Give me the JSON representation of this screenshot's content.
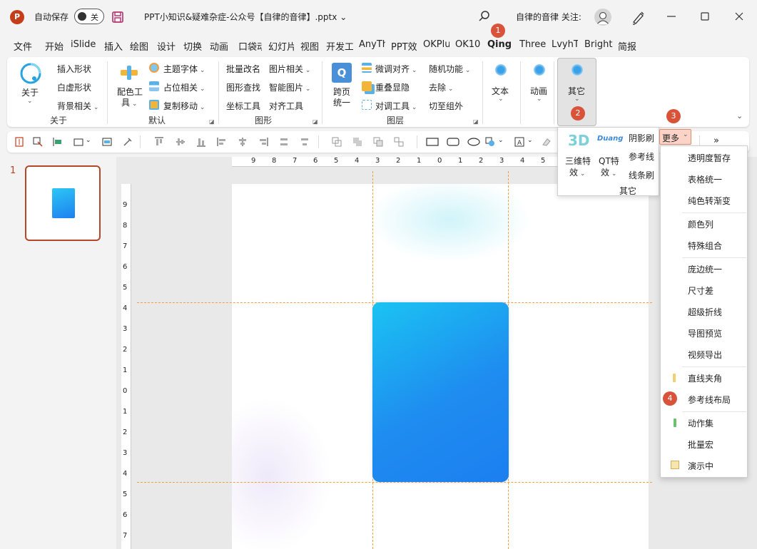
{
  "titlebar": {
    "autosave_label": "自动保存",
    "autosave_state": "关",
    "document_title": "PPT小知识&疑难杂症-公众号【自律的音律】.pptx",
    "title_caret": "⌄",
    "user_label": "自律的音律 关注:",
    "app_logo": "P"
  },
  "tabs": [
    {
      "label": "文件"
    },
    {
      "label": "开始"
    },
    {
      "label": "iSlide"
    },
    {
      "label": "插入"
    },
    {
      "label": "绘图"
    },
    {
      "label": "设计"
    },
    {
      "label": "切换"
    },
    {
      "label": "动画"
    },
    {
      "label": "口袋动"
    },
    {
      "label": "幻灯片"
    },
    {
      "label": "视图"
    },
    {
      "label": "开发工"
    },
    {
      "label": "AnyTh"
    },
    {
      "label": "PPT效"
    },
    {
      "label": "OKPlu"
    },
    {
      "label": "OK10"
    },
    {
      "label": "Qing"
    },
    {
      "label": "Three"
    },
    {
      "label": "LvyhT"
    },
    {
      "label": "Bright"
    },
    {
      "label": "简报"
    }
  ],
  "ribbon": {
    "about": {
      "label": "关于",
      "group": "关于"
    },
    "g1": {
      "insert_shape": "插入形状",
      "white_shape": "白虚形状",
      "bg_related": "背景相关"
    },
    "g2": {
      "color_tool_1": "配色工",
      "color_tool_2": "具",
      "theme_font": "主题字体",
      "placeholder": "占位相关",
      "copy_move": "复制移动",
      "group": "默认"
    },
    "g3": {
      "batch_rename": "批量改名",
      "image_related": "图片相关",
      "shape_find": "图形查找",
      "smart_image": "智能图片",
      "coord_tool": "坐标工具",
      "align_tool": "对齐工具",
      "group": "图形"
    },
    "g4": {
      "cross_page_1": "跨页",
      "cross_page_2": "统一",
      "fine_align": "微调对齐",
      "overlap_show": "重叠显隐",
      "align_tool2": "对调工具",
      "random_func": "随机功能",
      "remove": "去除",
      "cut_to_group": "切至组外",
      "group": "图层"
    },
    "g5": {
      "text": "文本",
      "animation": "动画",
      "other": "其它"
    }
  },
  "popup": {
    "three_d_icon": "3D",
    "three_d_1": "三维特",
    "three_d_2": "效",
    "qt_icon": "Duang",
    "qt_1": "QT特",
    "qt_2": "效",
    "shadow_brush": "阴影刷",
    "guide_line": "参考线",
    "line_brush": "线条刷",
    "more": "更多",
    "group": "其它"
  },
  "menu": [
    "透明度暂存",
    "表格统一",
    "纯色转渐变",
    "颜色列",
    "特殊组合",
    "庞边统一",
    "尺寸差",
    "超级折线",
    "导图预览",
    "视频导出",
    "直线夹角",
    "参考线布局",
    "动作集",
    "批量宏",
    "演示中"
  ],
  "thumbnail": {
    "slide_number": "1"
  },
  "ruler": {
    "horizontal": [
      "9",
      "8",
      "7",
      "6",
      "5",
      "4",
      "3",
      "2",
      "1",
      "0",
      "1",
      "2",
      "3",
      "4",
      "5"
    ],
    "vertical": [
      "9",
      "8",
      "7",
      "6",
      "5",
      "4",
      "3",
      "2",
      "1",
      "0",
      "1",
      "2",
      "3",
      "4",
      "5",
      "6",
      "7"
    ]
  },
  "badges": [
    "1",
    "2",
    "3",
    "4"
  ],
  "toolbar": {
    "overflow": "»"
  },
  "colors": {
    "accent": "#c43e1c",
    "badge": "#d9533b",
    "shape_start": "#1bc3f2",
    "shape_end": "#1c7ff0",
    "guide": "#f0a040"
  }
}
